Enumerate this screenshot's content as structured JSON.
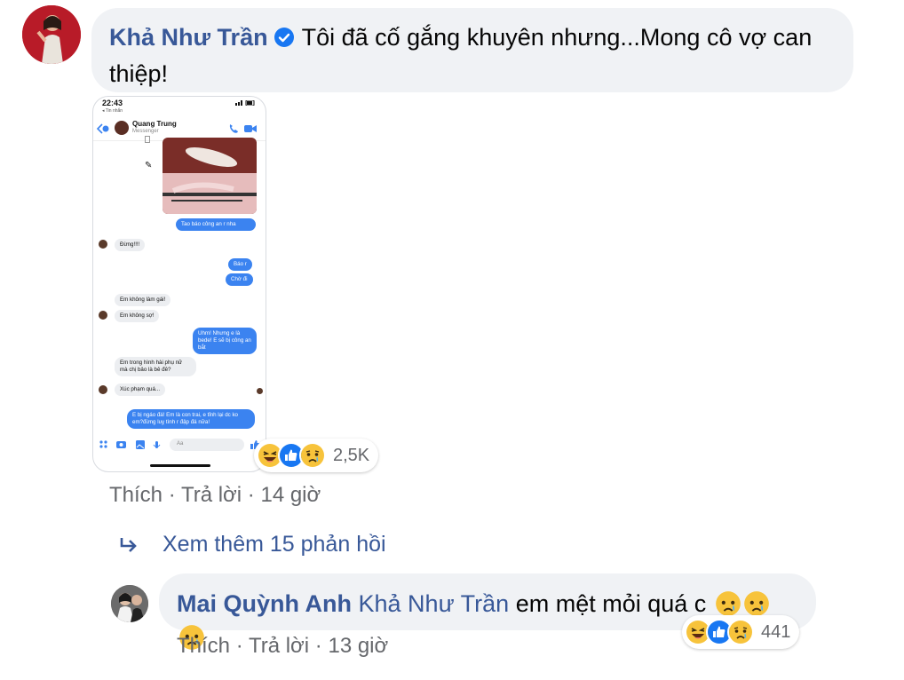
{
  "main_comment": {
    "author": "Khả Như Trần",
    "text": "Tôi đã cố gắng khuyên nhưng...Mong cô vợ can thiệp!",
    "reactions_count": "2,5K",
    "actions": {
      "like": "Thích",
      "reply": "Trả lời",
      "time": "14 giờ",
      "separator": "·"
    },
    "reaction_icons": [
      "haha-icon",
      "like-icon",
      "sad-icon"
    ]
  },
  "screenshot": {
    "time": "22:43",
    "back": "◂ Tin nhắn",
    "contact_name": "Quang Trung",
    "contact_sub": "Messenger",
    "messages": [
      {
        "dir": "out",
        "text": "Tao báo công an r nha"
      },
      {
        "dir": "in",
        "text": "Đừng!!!!"
      },
      {
        "dir": "out",
        "text": "Báo r"
      },
      {
        "dir": "out",
        "text": "Chờ đi"
      },
      {
        "dir": "in",
        "text": "Em không làm gái!"
      },
      {
        "dir": "in",
        "text": "Em không sợ!"
      },
      {
        "dir": "out",
        "text": "Uhm! Nhưng e là bede! E sẽ bị công an bắt"
      },
      {
        "dir": "in",
        "text": "Em trong hình hài phụ nữ mà chị bảo là bê đê?"
      },
      {
        "dir": "in",
        "text": "Xúc phạm quá..."
      },
      {
        "dir": "out",
        "text": "E bị ngáo đá! Em là con trai, e tỉnh lại dc ko em?đừng luỵ tình r đập đá nữa!"
      }
    ],
    "input_placeholder": "Aa"
  },
  "view_more": {
    "label": "Xem thêm 15 phản hồi"
  },
  "reply_comment": {
    "author": "Mai Quỳnh Anh",
    "mention": "Khả Như Trần",
    "text": "em mệt mỏi quá c",
    "reactions_count": "441",
    "actions": {
      "like": "Thích",
      "reply": "Trả lời",
      "time": "13 giờ",
      "separator": "·"
    }
  },
  "colors": {
    "link": "#385898",
    "bubble": "#f0f2f5",
    "meta": "#65676b",
    "messenger_blue": "#3b83f0"
  }
}
